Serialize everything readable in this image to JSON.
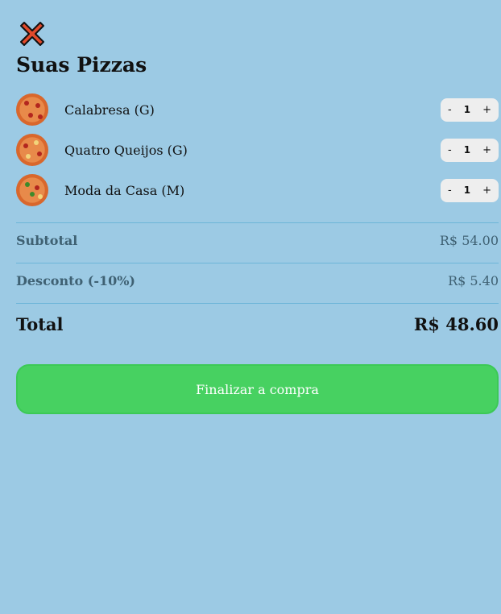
{
  "header": {
    "close_icon": "close-x-icon",
    "title": "Suas Pizzas"
  },
  "cart": {
    "items": [
      {
        "name": "Calabresa (G)",
        "quantity": "1",
        "minus": "-",
        "plus": "+",
        "image": "pizza-calabresa-image"
      },
      {
        "name": "Quatro Queijos (G)",
        "quantity": "1",
        "minus": "-",
        "plus": "+",
        "image": "pizza-quatro-queijos-image"
      },
      {
        "name": "Moda da Casa (M)",
        "quantity": "1",
        "minus": "-",
        "plus": "+",
        "image": "pizza-moda-da-casa-image"
      }
    ]
  },
  "summary": {
    "subtotal_label": "Subtotal",
    "subtotal_value": "R$ 54.00",
    "discount_label": "Desconto (-10%)",
    "discount_value": "R$ 5.40",
    "total_label": "Total",
    "total_value": "R$ 48.60"
  },
  "checkout": {
    "label": "Finalizar a compra"
  },
  "colors": {
    "background": "#9ccae4",
    "button": "#47d161",
    "close_icon": "#e24a2b",
    "muted_text": "#3f6173"
  }
}
